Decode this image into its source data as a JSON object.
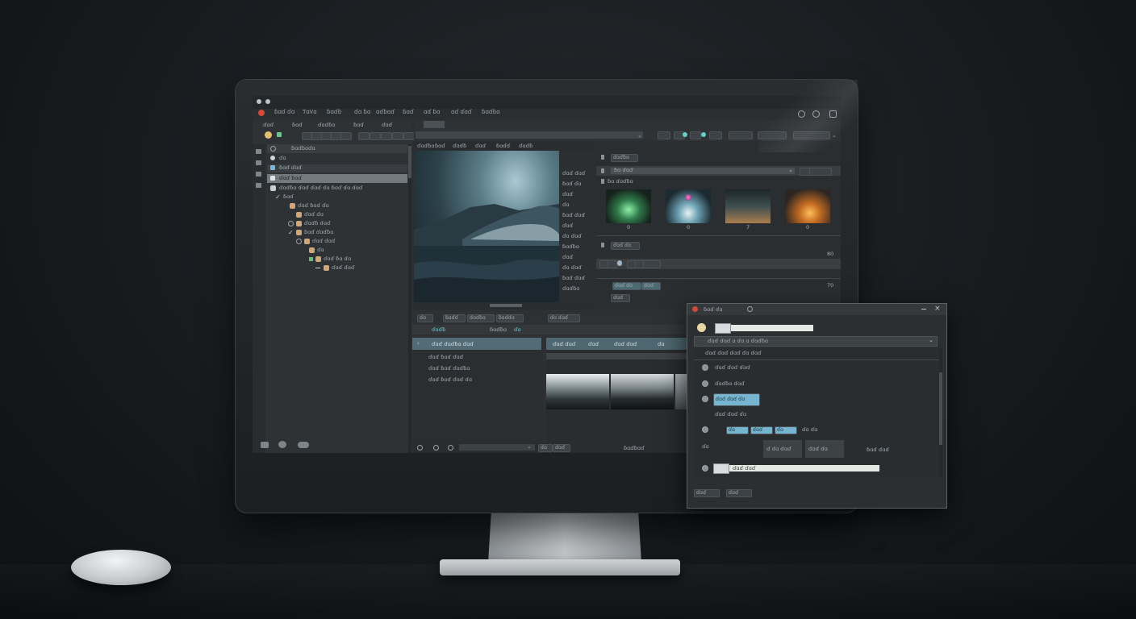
{
  "window": {
    "title_icons": [
      "app-icon",
      "app-icon-2"
    ],
    "controls": [
      "minimize-icon",
      "maximize-icon",
      "close-icon"
    ]
  },
  "menubar": {
    "items": [
      "ɓɑɗ ɗɑ",
      "TɑᏙɑ",
      "ɓɑɗɓ",
      "ɗɑ ɓɑ",
      "ɑɗɓɑɗ",
      "ɓɑɗ",
      "ɑɗ ɓɑ",
      "ɑɗ ɗɑɗ",
      "ɓɑɗɓɑ"
    ]
  },
  "left_panel": {
    "tabs": [
      "ɗɑɗ",
      "ɓɑɗ",
      "ɗɑɗɓɑ",
      "ɓɑɗ",
      "ɗɑɗ"
    ],
    "header": "ɓɑɗɓɑɗɑ",
    "tree": [
      {
        "label": "ɗɑ",
        "indent": 0
      },
      {
        "label": "ɓɑɗ ɗɑɗ",
        "indent": 0
      },
      {
        "label": "ɗɑɗ ɓɑɗ",
        "indent": 0
      },
      {
        "label": "ɗɑɗɓɑ ɗɑɗ ɗɑɗ ɗɑ ɓɑɗ ɗɑ ɗɑɗ",
        "indent": 0
      },
      {
        "label": "ɓɑɗ",
        "indent": 1
      },
      {
        "label": "ɗɑɗ ɓɑɗ ɗɑ",
        "indent": 2
      },
      {
        "label": "ɗɑɗ ɗɑ",
        "indent": 2
      },
      {
        "label": "ɗɑɗɓ ɗɑɗ",
        "indent": 2
      },
      {
        "label": "ɓɑɗ ɗɑɗɓɑ",
        "indent": 3
      },
      {
        "label": "ɗɑɗ ɗɑɗ",
        "indent": 3
      },
      {
        "label": "ɗɑ",
        "indent": 4
      },
      {
        "label": "ɗɑɗ ɓɑ ɗɑ",
        "indent": 4
      },
      {
        "label": "ɗɑɗ ɗɑɗ",
        "indent": 5
      }
    ]
  },
  "viewer": {
    "toolbar": [
      "ɗɑɗɓɑ",
      "ɓɑɗ",
      "ɗɑɗɓ",
      "ɗɑɗ",
      "ɓɑɗɗ",
      "ɗɑɗɓ"
    ],
    "side_labels": [
      "ɗɑɗ ɗɑɗ",
      "ɓɑɗ ɗɑ",
      "ɗɑɗ",
      "ɗɑ",
      "ɓɑɗ ɗɑɗ",
      "ɗɑɗ",
      "ɗɑ ɗɑɗ",
      "ɓɑɗɓɑ",
      "ɗɑɗ",
      "ɗɑ ɗɑɗ",
      "ɓɑɗ ɗɑɗ",
      "ɗɑɗɓɑ"
    ]
  },
  "effects_panel": {
    "header": "ɗɑɗɓɑ",
    "dropdown": "ɓɑ ɗɑɗ",
    "section": "ɓɑ ɗɑɗɓɑ",
    "thumbs": [
      "0",
      "0",
      "7",
      "0"
    ],
    "section2": "ɗɑɗ ɗɑ",
    "numbers": [
      "80",
      "70"
    ],
    "buttons": [
      "ɗɑɗ ɗɑ",
      "ɗɑɗ"
    ],
    "footer": "ɗɑɗ"
  },
  "timeline": {
    "tabs": [
      "ɗɑ",
      "ɓɑɗɗ",
      "ɗɑɗɓɑ",
      "ɓɑɗɗɑ",
      "ɗɑ ɗɑɗ"
    ],
    "ruler": [
      "ɗɑɗɓ",
      "ɓɑɗɓɑ",
      "ɗɑ"
    ],
    "tracks": [
      {
        "label": "ɗɑɗ ɗɑɗɓɑ ɗɑɗ"
      },
      {
        "label": "ɗɑɗ ɓɑɗ ɗɑɗ"
      },
      {
        "label": "ɗɑɗ ɓɑɗ ɗɑɗɓɑ"
      },
      {
        "label": "ɗɑɗ ɓɑɗ ɗɑɗ ɗɑ"
      }
    ],
    "clip_labels": [
      "ɗɑɗ ɗɑɗ",
      "ɗɑɗ",
      "ɗɑɗ ɗɑɗ",
      "ɗɑ"
    ],
    "footer_label": "ɓɑɗɓɑɗ",
    "footer_buttons": [
      "ɗɑ",
      "ɗɑɗ"
    ]
  },
  "dialog": {
    "title": "ɓɑɗ ɗɑ",
    "field_value": "",
    "select": "ɗɑɗ ɗɑɗ ɑ ɗɑ ɑ ɗɑɗɓɑ",
    "rows": [
      "ɗɑɗ ɗɑɗ ɗɑɗ ɗɑ ɗɑɗ",
      "ɗɑɗ ɗɑɗ ɗɑɗ",
      "ɗɑɗɓɑ ɗɑɗ",
      "ɗɑɗ ɗɑɗ ɗɑ",
      "ɓɑɗɗɑ ɗɑɗ ɗɑ"
    ],
    "highlight_button": "ɗɑɗ ɗɑɗ ɗɑ",
    "chips": [
      "ɗɑ",
      "ɗɑɗ",
      "ɗɑ"
    ],
    "chip_tail": "ɗɑ ɗɑ",
    "sub_left": "ɗɑ",
    "sub_cells": [
      "ɗ ɗɑ ɗɑɗ",
      "ɗɑɗ ɗɑ"
    ],
    "sub_right": "ɓɑɗ ɗɑɗ",
    "input_label": "ɗɑɗ ɗɑɗ",
    "ok_label": "ɗɑɗ",
    "cancel_label": "ɗɑɗ"
  }
}
